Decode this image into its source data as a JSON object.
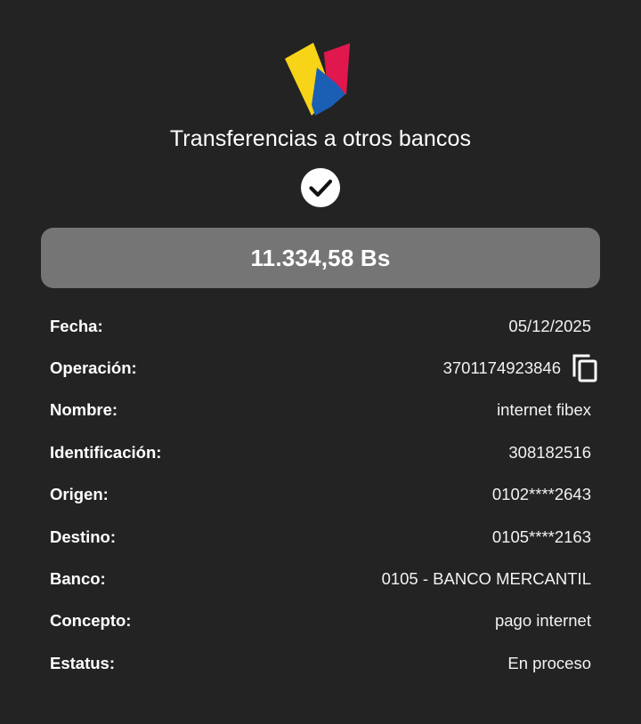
{
  "header": {
    "logo_icon": "bank-logo-icon",
    "title": "Transferencias a otros bancos",
    "status_icon": "check-circle-icon"
  },
  "amount": "11.334,58 Bs",
  "details": [
    {
      "label": "Fecha:",
      "value": "05/12/2025"
    },
    {
      "label": "Operación:",
      "value": "3701174923846",
      "action_icon": "copy-icon"
    },
    {
      "label": "Nombre:",
      "value": "internet fibex"
    },
    {
      "label": "Identificación:",
      "value": "308182516"
    },
    {
      "label": "Origen:",
      "value": "0102****2643"
    },
    {
      "label": "Destino:",
      "value": "0105****2163"
    },
    {
      "label": "Banco:",
      "value": "0105 - BANCO MERCANTIL"
    },
    {
      "label": "Concepto:",
      "value": "pago internet"
    },
    {
      "label": "Estatus:",
      "value": "En proceso"
    }
  ],
  "colors": {
    "background": "#232323",
    "amount_box": "#757575",
    "logo_yellow": "#f7d417",
    "logo_blue": "#1a5fb4",
    "logo_red": "#e0184e"
  }
}
